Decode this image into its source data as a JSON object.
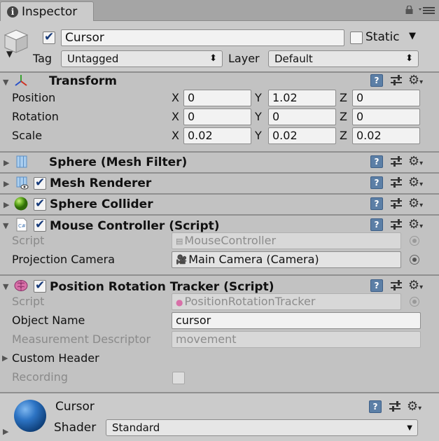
{
  "window": {
    "tab_title": "Inspector"
  },
  "gameobject": {
    "active": true,
    "name": "Cursor",
    "static_label": "Static",
    "static_checked": false,
    "tag_label": "Tag",
    "tag_value": "Untagged",
    "layer_label": "Layer",
    "layer_value": "Default"
  },
  "transform": {
    "title": "Transform",
    "position": {
      "label": "Position",
      "x": "0",
      "y": "1.02",
      "z": "0"
    },
    "rotation": {
      "label": "Rotation",
      "x": "0",
      "y": "0",
      "z": "0"
    },
    "scale": {
      "label": "Scale",
      "x": "0.02",
      "y": "0.02",
      "z": "0.02"
    },
    "axis_x": "X",
    "axis_y": "Y",
    "axis_z": "Z"
  },
  "components": {
    "mesh_filter": {
      "title": "Sphere (Mesh Filter)"
    },
    "mesh_renderer": {
      "title": "Mesh Renderer",
      "enabled": true
    },
    "sphere_collider": {
      "title": "Sphere Collider",
      "enabled": true
    },
    "mouse_controller": {
      "title": "Mouse Controller (Script)",
      "enabled": true,
      "script_label": "Script",
      "script_value": "MouseController",
      "camera_label": "Projection Camera",
      "camera_value": "Main Camera (Camera)"
    },
    "tracker": {
      "title": "Position Rotation Tracker (Script)",
      "enabled": true,
      "script_label": "Script",
      "script_value": "PositionRotationTracker",
      "object_name_label": "Object Name",
      "object_name_value": "cursor",
      "measurement_label": "Measurement Descriptor",
      "measurement_value": "movement",
      "custom_header_label": "Custom Header",
      "recording_label": "Recording",
      "recording_checked": false
    }
  },
  "material": {
    "name": "Cursor",
    "shader_label": "Shader",
    "shader_value": "Standard"
  },
  "icons": {
    "help": "help-icon",
    "preset": "preset-icon",
    "gear": "gear-icon",
    "lock": "lock-icon",
    "menu": "menu-icon",
    "info": "info-icon"
  },
  "colors": {
    "panel": "#c2c2c2",
    "header": "#cbcbcb",
    "help_blue": "#5c7fa6"
  }
}
